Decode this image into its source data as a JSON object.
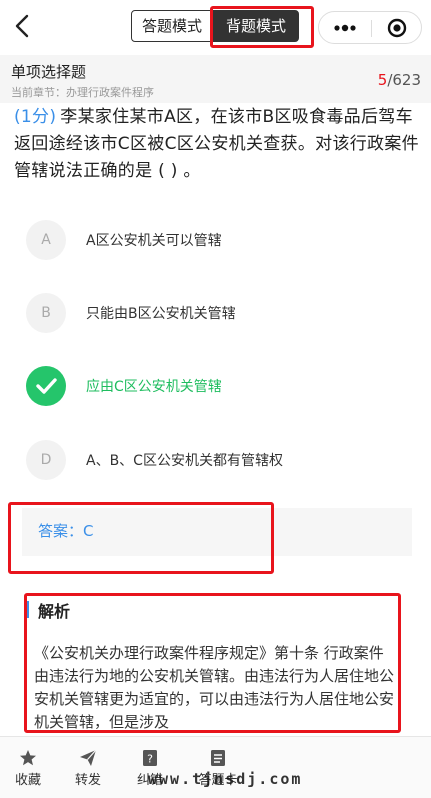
{
  "nav": {
    "mode_answer": "答题模式",
    "mode_recite": "背题模式"
  },
  "chapter": {
    "question_type": "单项选择题",
    "current_chapter": "当前章节：办理行政案件程序",
    "progress_current": "5",
    "progress_total": "/623"
  },
  "question": {
    "score": "(1分)",
    "text": "李某家住某市A区，在该市B区吸食毒品后驾车返回途经该市C区被C区公安机关查获。对该行政案件管辖说法正确的是 ( ) 。"
  },
  "options": [
    {
      "letter": "A",
      "text": "A区公安机关可以管辖",
      "correct": false
    },
    {
      "letter": "B",
      "text": "只能由B区公安机关管辖",
      "correct": false
    },
    {
      "letter": "C",
      "text": "应由C区公安机关管辖",
      "correct": true
    },
    {
      "letter": "D",
      "text": "A、B、C区公安机关都有管辖权",
      "correct": false
    }
  ],
  "answer": {
    "text": "答案：C"
  },
  "analysis": {
    "title": "解析",
    "body": "《公安机关办理行政案件程序规定》第十条 行政案件由违法行为地的公安机关管辖。由违法行为人居住地公安机关管辖更为适宜的，可以由违法行为人居住地公安机关管辖，但是涉及"
  },
  "bottom_tabs": [
    {
      "label": "收藏",
      "icon": "star-icon"
    },
    {
      "label": "转发",
      "icon": "send-icon"
    },
    {
      "label": "纠错",
      "icon": "report-icon"
    },
    {
      "label": "答题卡",
      "icon": "answer-sheet-icon"
    }
  ],
  "watermark": "www.tjnsdj.com",
  "colors": {
    "accent_blue": "#3a8fe8",
    "correct_green": "#25c56b",
    "highlight_red": "#e8141c"
  }
}
